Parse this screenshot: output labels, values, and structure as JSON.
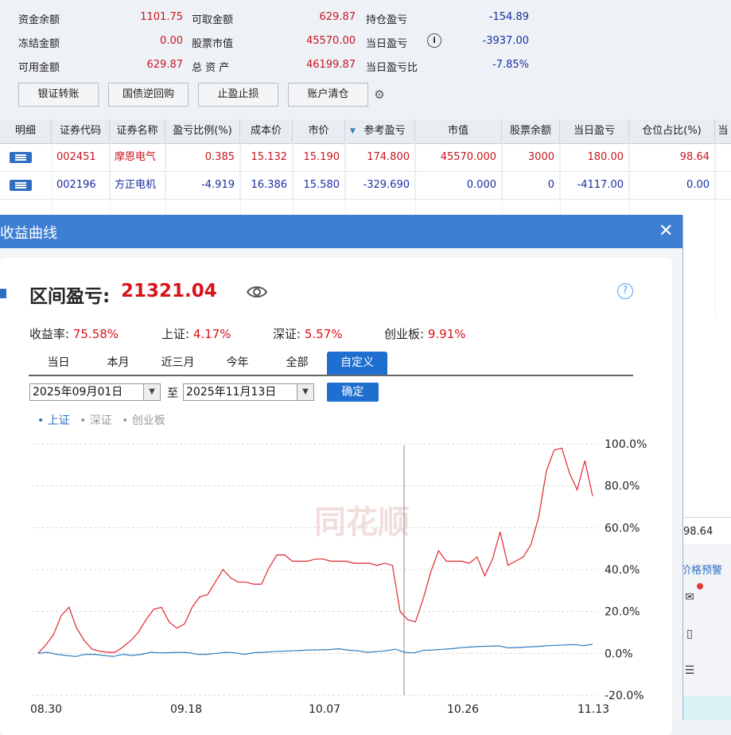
{
  "account": {
    "rows": [
      [
        {
          "label": "资金余额",
          "value": "1101.75"
        },
        {
          "label": "可取金额",
          "value": "629.87"
        },
        {
          "label": "持仓盈亏",
          "value": "-154.89"
        }
      ],
      [
        {
          "label": "冻结金额",
          "value": "0.00"
        },
        {
          "label": "股票市值",
          "value": "45570.00"
        },
        {
          "label": "当日盈亏",
          "value": "-3937.00"
        }
      ],
      [
        {
          "label": "可用金额",
          "value": "629.87"
        },
        {
          "label": "总 资 产",
          "value": "46199.87"
        },
        {
          "label": "当日盈亏比",
          "value": "-7.85%"
        }
      ]
    ]
  },
  "toolbar": {
    "buttons": [
      "银证转账",
      "国债逆回购",
      "止盈止损",
      "账户清仓"
    ]
  },
  "grid": {
    "columns": [
      "明细",
      "证券代码",
      "证券名称",
      "盈亏比例(%)",
      "成本价",
      "市价",
      "参考盈亏",
      "市值",
      "股票余额",
      "当日盈亏",
      "仓位占比(%)",
      "当"
    ],
    "rows": [
      [
        "002451",
        "摩恩电气",
        "0.385",
        "15.132",
        "15.190",
        "174.800",
        "45570.000",
        "3000",
        "180.00",
        "98.64"
      ],
      [
        "002196",
        "方正电机",
        "-4.919",
        "16.386",
        "15.580",
        "-329.690",
        "0.000",
        "0",
        "-4117.00",
        "0.00"
      ]
    ]
  },
  "side": {
    "value": "98.64",
    "link": "价格预警"
  },
  "dialog": {
    "title": "收益曲线",
    "pnl_label": "区间盈亏:",
    "pnl_value": "21321.04",
    "stats": [
      {
        "label": "收益率:",
        "value": "75.58%"
      },
      {
        "label": "上证:",
        "value": "4.17%"
      },
      {
        "label": "深证:",
        "value": "5.57%"
      },
      {
        "label": "创业板:",
        "value": "9.91%"
      }
    ],
    "tabs": [
      "当日",
      "本月",
      "近三月",
      "今年",
      "全部",
      "自定义"
    ],
    "active_tab": "自定义",
    "date_from": "2025年09月01日",
    "date_sep": "至",
    "date_to": "2025年11月13日",
    "confirm": "确定",
    "legend": [
      "上证",
      "深证",
      "创业板"
    ],
    "watermark": "同花顺"
  },
  "chart_data": {
    "type": "line",
    "x_ticks": [
      "08.30",
      "09.18",
      "10.07",
      "10.26",
      "11.13"
    ],
    "y_ticks": [
      "100.0%",
      "80.0%",
      "60.0%",
      "40.0%",
      "20.0%",
      "0.0%",
      "-20.0%"
    ],
    "ylim": [
      -20,
      100
    ],
    "series": [
      {
        "name": "收益率",
        "color": "#e0262e",
        "values": [
          0,
          4,
          9,
          18,
          22,
          12,
          6,
          2,
          1,
          0.5,
          0.5,
          3,
          6,
          10,
          16,
          21,
          22,
          15,
          12,
          14,
          22,
          27,
          28,
          34,
          40,
          36,
          34,
          34,
          33,
          33,
          41,
          47,
          47,
          44,
          44,
          44,
          45,
          45,
          44,
          44,
          44,
          43,
          43,
          43,
          42,
          43,
          42,
          20,
          16,
          15,
          26,
          39,
          49,
          44,
          44,
          44,
          43,
          46,
          37,
          45,
          58,
          42,
          44,
          46,
          52,
          65,
          87,
          97,
          98,
          86,
          78,
          92,
          75
        ]
      },
      {
        "name": "上证",
        "color": "#2f7ec0",
        "values": [
          0,
          0.5,
          -0.5,
          -1,
          -1.5,
          -0.5,
          -0.5,
          -1,
          -1.5,
          -0.5,
          -1,
          -0.5,
          0.5,
          0.2,
          0.3,
          0.5,
          0.3,
          -0.5,
          -0.5,
          0,
          0.5,
          0.2,
          -0.5,
          0.3,
          0.5,
          0.8,
          1,
          1.2,
          1.4,
          1.6,
          1.7,
          1.8,
          2.2,
          1.5,
          1.2,
          0.5,
          0.8,
          1.2,
          2,
          0.5,
          0.2,
          1.4,
          1.6,
          1.9,
          2.2,
          2.7,
          3,
          3.3,
          3.4,
          3.6,
          2.6,
          2.8,
          3,
          3.2,
          3.6,
          3.8,
          4,
          4.2,
          3.7,
          4.3
        ]
      }
    ]
  }
}
